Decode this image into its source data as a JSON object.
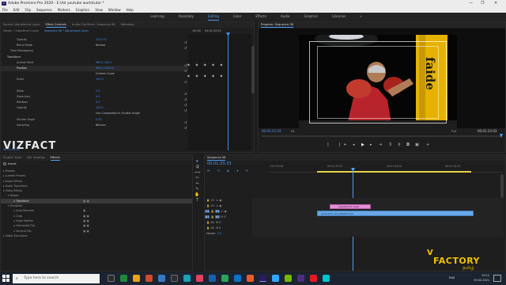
{
  "window": {
    "title": "Adobe Premiere Pro 2020 - E:\\Ad youtube work\\tutor *",
    "controls": [
      "—",
      "❐",
      "✕"
    ]
  },
  "menu": [
    "File",
    "Edit",
    "Clip",
    "Sequence",
    "Markers",
    "Graphics",
    "View",
    "Window",
    "Help"
  ],
  "workspaces": {
    "items": [
      "Learning",
      "Assembly",
      "Editing",
      "Color",
      "Effects",
      "Audio",
      "Graphics",
      "Libraries"
    ],
    "active": "Editing",
    "more": "»"
  },
  "effect_controls": {
    "tabs": [
      "Source: Adjustment Layer",
      "Effect Controls",
      "Audio Clip Mixer: Sequence 06",
      "Metadata"
    ],
    "master_label": "Master * Adjustment Layer",
    "sequence_label": "Sequence 06 * Adjustment Layer",
    "timecode_start": ":00:00",
    "timecode_playhead": "00:01:33:25",
    "rows": [
      {
        "label": "Opacity",
        "value": "100.0 %"
      },
      {
        "label": "Blend Mode",
        "value": "Normal"
      },
      {
        "label": "Time Remapping",
        "value": ""
      },
      {
        "label": "Transform",
        "value": ""
      },
      {
        "label": "Anchor Point",
        "value": "960.0   540.0"
      },
      {
        "label": "Position",
        "value": "960.0   1013.0"
      },
      {
        "label": "",
        "value": "Uniform Scale"
      },
      {
        "label": "Scale",
        "value": "100.0"
      },
      {
        "label": "",
        "value": ""
      },
      {
        "label": "Skew",
        "value": "0.0"
      },
      {
        "label": "Skew Axis",
        "value": "0.0"
      },
      {
        "label": "Rotation",
        "value": "0.0"
      },
      {
        "label": "Opacity",
        "value": "100.0"
      },
      {
        "label": "",
        "value": "Use Composition's Shutter Angle"
      },
      {
        "label": "Shutter Angle",
        "value": "0.00"
      },
      {
        "label": "Sampling",
        "value": "Bilinear"
      }
    ],
    "footer_time": "00:01:33:25"
  },
  "watermark": "VIZFACT",
  "program": {
    "tab": "Program: Sequence 06",
    "timecode_left": "00:01:33:33",
    "fit": "Fit",
    "quality": "Full",
    "timecode_right": "00:01:33:03",
    "frame_text": "faide"
  },
  "project": {
    "tabs": [
      "Project: tutor",
      "Bin: shaking",
      "Effects"
    ],
    "search": "transf",
    "items": [
      {
        "label": "Presets",
        "indent": 0
      },
      {
        "label": "Lumetri Presets",
        "indent": 0
      },
      {
        "label": "Audio Effects",
        "indent": 0
      },
      {
        "label": "Audio Transitions",
        "indent": 0
      },
      {
        "label": "Video Effects",
        "indent": 0
      },
      {
        "label": "Distort",
        "indent": 1
      },
      {
        "label": "Transform",
        "indent": 2
      },
      {
        "label": "Transition",
        "indent": 1
      },
      {
        "label": "Auto-Reframe",
        "indent": 2
      },
      {
        "label": "Crop",
        "indent": 2
      },
      {
        "label": "Edge Feather",
        "indent": 2
      },
      {
        "label": "Horizontal Flip",
        "indent": 2
      },
      {
        "label": "Vertical Flip",
        "indent": 2
      },
      {
        "label": "Video Transitions",
        "indent": 0
      }
    ]
  },
  "timeline": {
    "tab": "Sequence 06",
    "timecode": "00:01:33:33",
    "ruler": [
      "1:01:33:00",
      "00:01:33:33",
      "00:01:34:00",
      "00:01:34:23"
    ],
    "tracks": [
      "V3",
      "V2",
      "V1",
      "A1",
      "A2",
      "A3"
    ],
    "master": "Master",
    "master_val": "0.0",
    "clip_adj": "Adjustment Layer",
    "clip_video": "production 03_shilpibhnvat"
  },
  "branding": {
    "v": "V",
    "factory": "FACTORY",
    "tamil": "தமிழ்"
  },
  "taskbar": {
    "search": "Type here to search",
    "time": "20:12",
    "date": "09-02-2021",
    "lang": "ENG"
  },
  "colors": {
    "accent": "#4e9ef6",
    "adjustment_clip": "#e48fd7",
    "video_clip": "#6aa8e6",
    "brand_yellow": "#f2c200"
  }
}
